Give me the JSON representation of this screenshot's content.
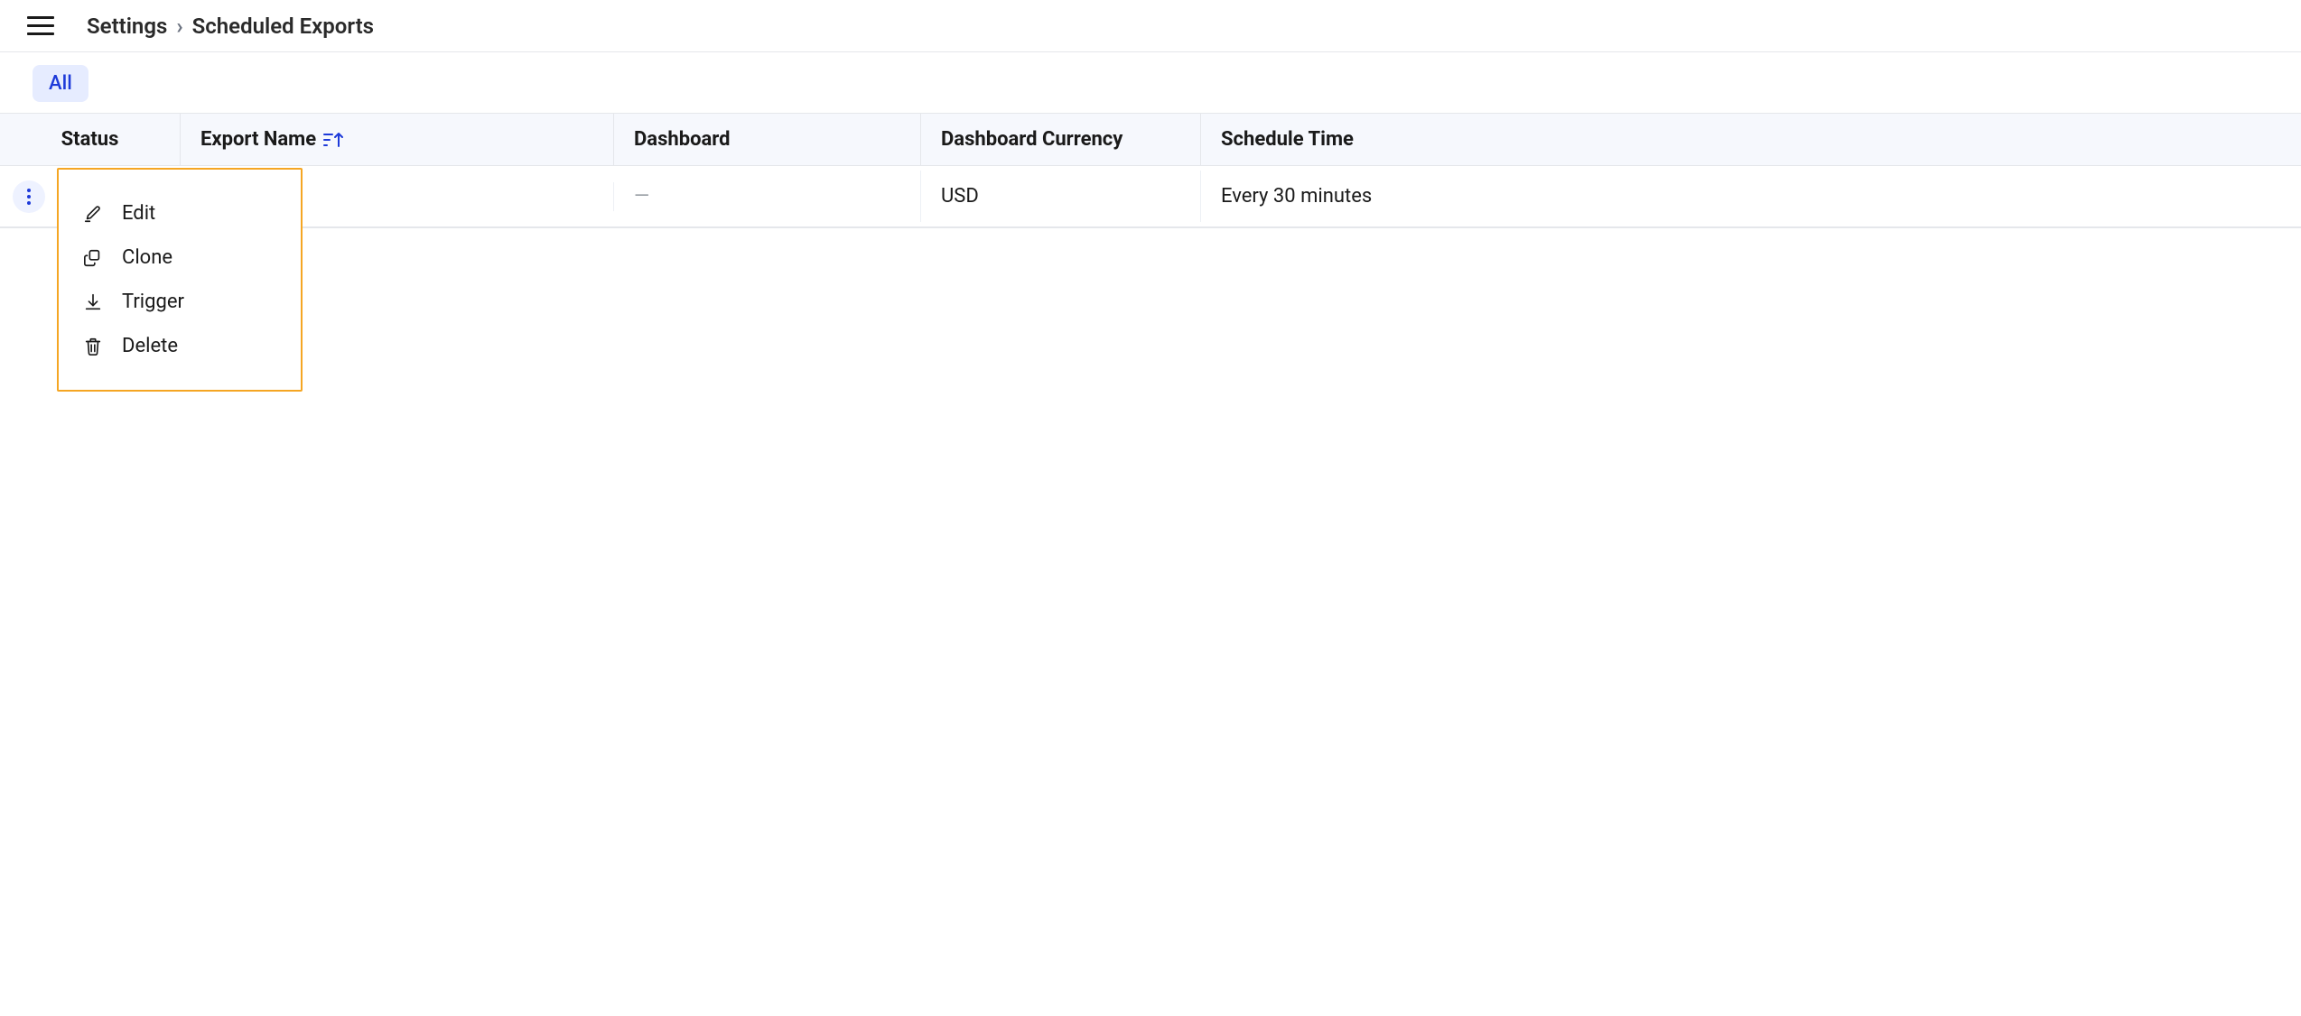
{
  "breadcrumb": {
    "root": "Settings",
    "page": "Scheduled Exports"
  },
  "filters": {
    "all": "All"
  },
  "columns": {
    "status": "Status",
    "export_name": "Export Name",
    "dashboard": "Dashboard",
    "currency": "Dashboard Currency",
    "schedule": "Schedule Time"
  },
  "row": {
    "status": "",
    "export_name": "",
    "dashboard": "—",
    "currency": "USD",
    "schedule": "Every 30 minutes"
  },
  "menu": {
    "edit": "Edit",
    "clone": "Clone",
    "trigger": "Trigger",
    "delete": "Delete"
  }
}
